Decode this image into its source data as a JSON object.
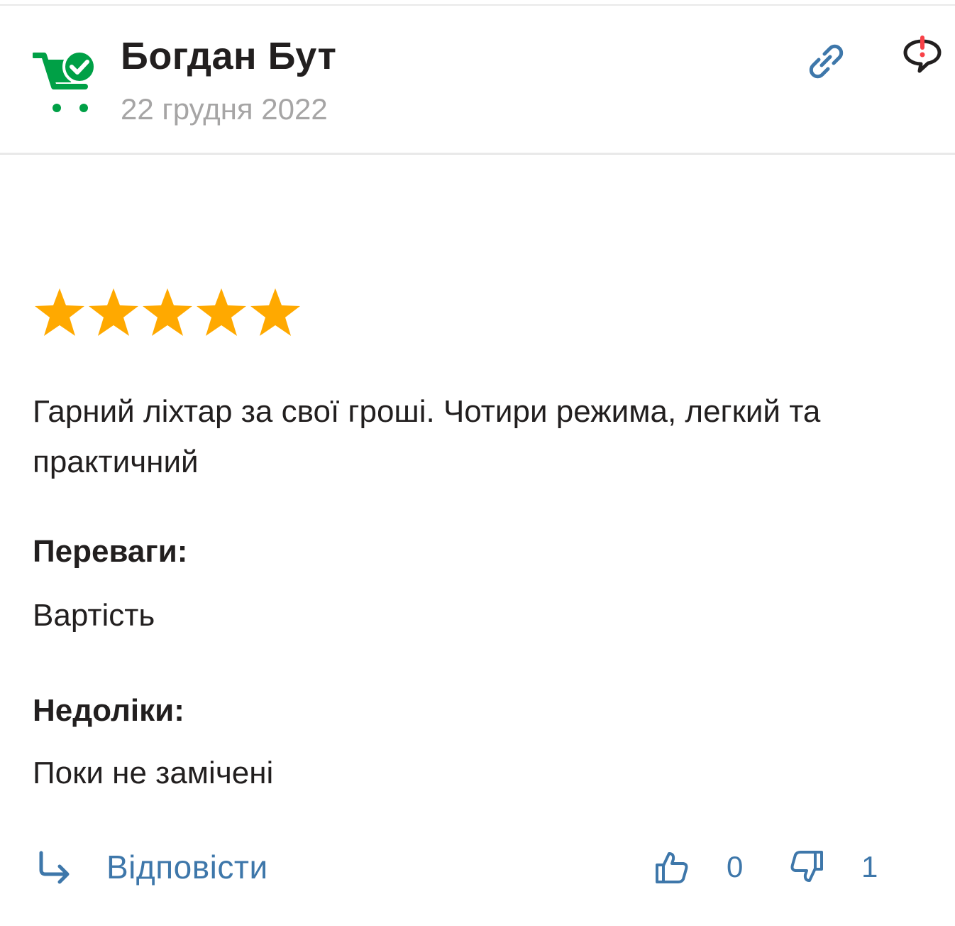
{
  "review": {
    "author": "Богдан Бут",
    "date": "22 грудня 2022",
    "rating": 5,
    "rating_max": 5,
    "text": "Гарний ліхтар за свої гроші. Чотири режима, легкий та практичний",
    "pros_title": "Переваги:",
    "pros_value": "Вартість",
    "cons_title": "Недоліки:",
    "cons_value": "Поки не замічені"
  },
  "icons": {
    "avatar": "verified-buyer-cart-icon",
    "link": "link-icon",
    "complain": "complain-icon",
    "reply": "reply-arrow-icon",
    "like": "thumb-up-icon",
    "dislike": "thumb-down-icon"
  },
  "actions": {
    "reply_label": "Відповісти",
    "likes": "0",
    "dislikes": "1"
  },
  "colors": {
    "accent": "#3e77aa",
    "star": "#ffa900",
    "verified": "#00a046",
    "muted": "#a6a5a5",
    "alert": "#f84147"
  }
}
